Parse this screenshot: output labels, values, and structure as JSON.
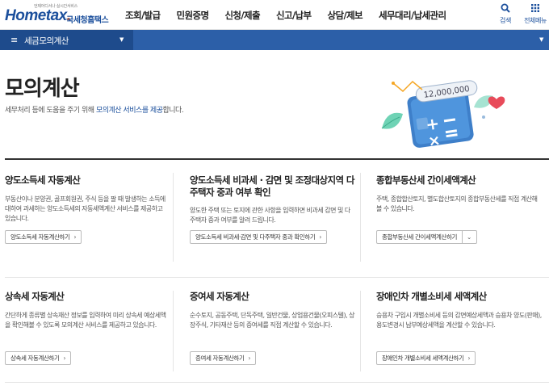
{
  "header": {
    "logo_tagline": "언제어디서나 실시간서비스",
    "logo_brand": "Hometax",
    "logo_dot": ".",
    "logo_kr": "국세청홈택스",
    "nav": [
      "조회/발급",
      "민원증명",
      "신청/제출",
      "신고/납부",
      "상담/제보",
      "세무대리/납세관리"
    ],
    "search_icon_label": "검색",
    "menu_icon_label": "전체메뉴"
  },
  "menubar": {
    "burger": "≡",
    "title": "세금모의계산"
  },
  "page": {
    "title": "모의계산",
    "desc_before": "세무처리 등에 도움을 주기 위해 ",
    "desc_highlight": "모의계산 서비스를 제공",
    "desc_after": "합니다.",
    "illustration_amount": "12,000,000"
  },
  "cards": [
    {
      "title": "양도소득세 자동계산",
      "desc": "부동산이나 분양권, 골프회원권, 주식 등을 팔 때 발생하는 소득에 대하여 과세하는 양도소득세의 자동세액계산 서비스를 제공하고있습니다.",
      "button": "양도소득세 자동계산하기",
      "chev": "›"
    },
    {
      "title": "양도소득세 비과세 · 감면 및 조정대상지역 다주택자 중과 여부 확인",
      "desc": "양도한 주택 또는 토지에 관한 사항을 입력하면 비과세 감면 및 다주택자 중과 여부를 알려 드립니다.",
      "button": "양도소득세 비과세·감면 및 다주택자 중과 확인하기",
      "chev": "›"
    },
    {
      "title": "종합부동산세 간이세액계산",
      "desc": "주택, 종합합산토지, 별도합산토지의 종합부동산세를 직접 계산해 볼 수 있습니다.",
      "button": "종합부동산세 간이세액계산하기",
      "chev": "⌄"
    },
    {
      "title": "상속세 자동계산",
      "desc": "간단하게 종류별 상속재산 정보를 입력하여 미리 상속세 예상세액을 확인해볼 수 있도록 모의계산 서비스를 제공하고 있습니다.",
      "button": "상속세 자동계산하기",
      "chev": "›"
    },
    {
      "title": "증여세 자동계산",
      "desc": "순수토지, 공동주택, 단독주택, 일반건물, 상업용건물(오피스텔), 상장주식, 기타재산 등의 증여세를 직접 계산할 수 있습니다.",
      "button": "증여세 자동계산하기",
      "chev": "›"
    },
    {
      "title": "장애인차 개별소비세 세액계산",
      "desc": "승용차 구입시 개별소비세 등의 감면예상세액과 승용차 양도(판매), 용도변경시 납부예상세액을 계산할 수 있습니다.",
      "button": "장애인차 개별소비세 세액계산하기",
      "chev": "›"
    }
  ],
  "colors": {
    "brand": "#1b4f9c",
    "menubar": "#2c5fa8",
    "menubar_left": "#1e4b8c",
    "logo_accent": "#e8591a"
  }
}
